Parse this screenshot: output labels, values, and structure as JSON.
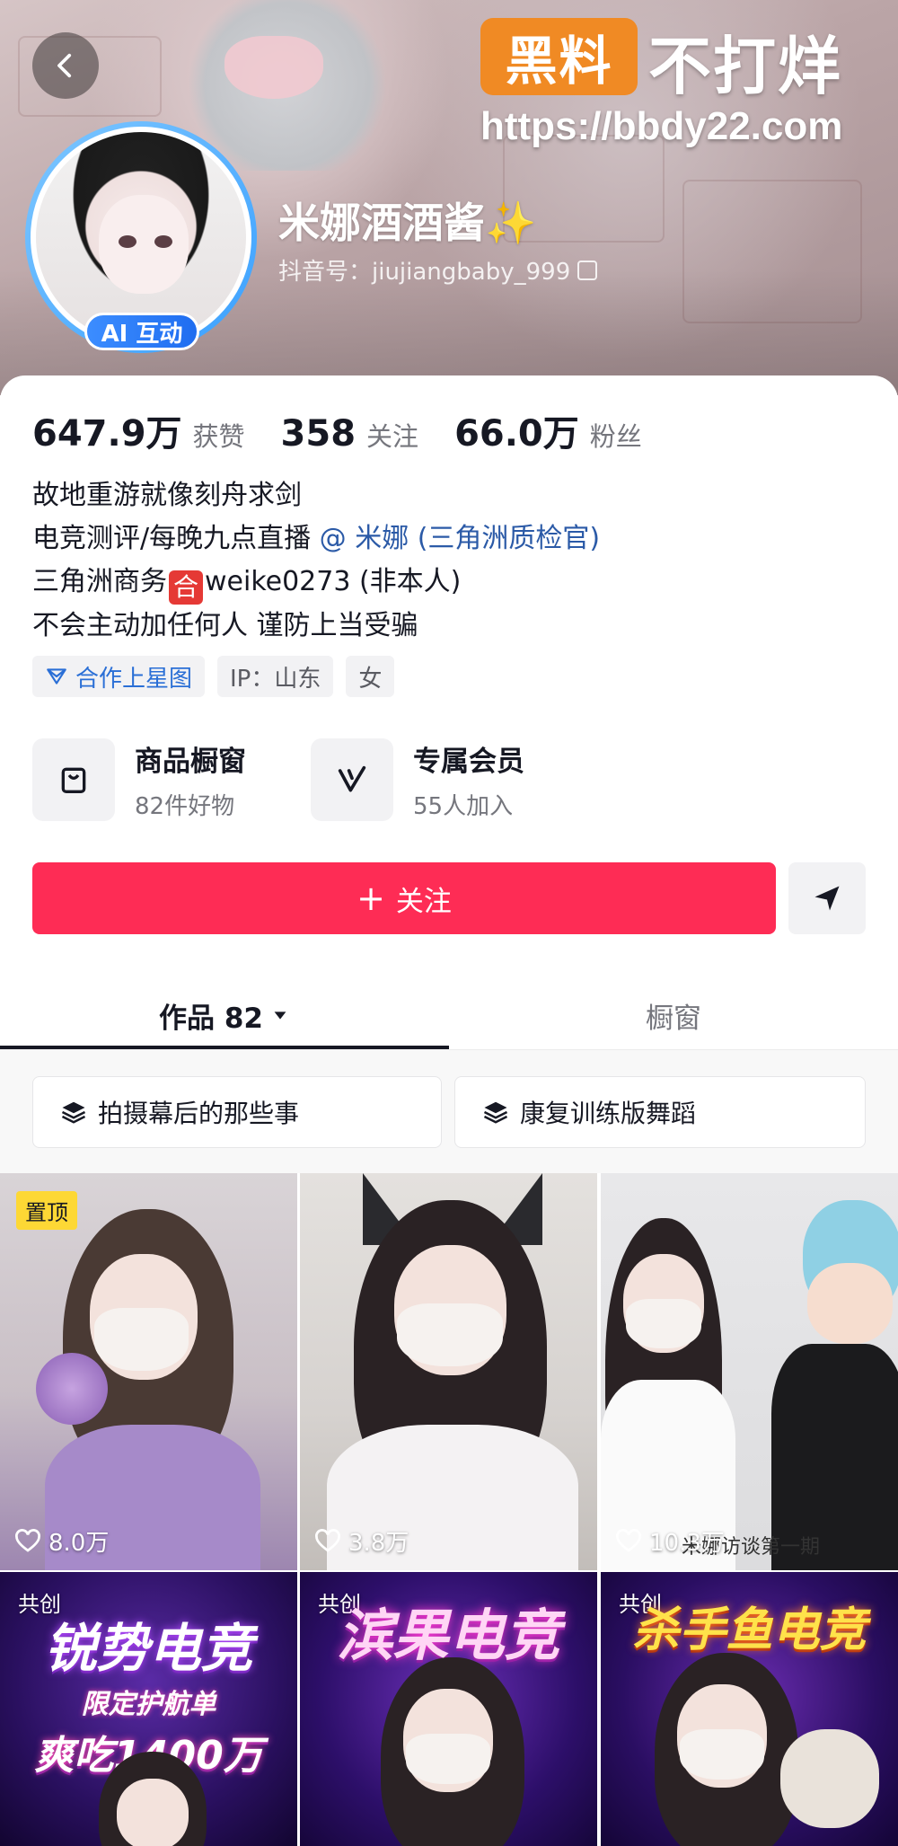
{
  "header": {
    "back_icon": "chevron-left-icon",
    "watermark_logo": "黑料",
    "watermark_text": "不打烊",
    "watermark_url": "https://bbdy22.com"
  },
  "profile": {
    "nickname": "米娜酒酒酱✨",
    "douyin_id": "抖音号：jiujiangbaby_999",
    "ai_badge": "AI 互动"
  },
  "stats": [
    {
      "value": "647.9万",
      "label": "获赞"
    },
    {
      "value": "358",
      "label": "关注"
    },
    {
      "value": "66.0万",
      "label": "粉丝"
    }
  ],
  "bio": {
    "line1": "故地重游就像刻舟求剑",
    "line2_prefix": "电竞测评/每晚九点直播",
    "line2_mention": "@ 米娜 (三角洲质检官)",
    "line3_prefix": "三角洲商务",
    "line3_icon": "合",
    "line3_suffix": "weike0273 (非本人)",
    "line4": "不会主动加任何人 谨防上当受骗"
  },
  "tags": {
    "star": "合作上星图",
    "ip": "IP：山东",
    "gender": "女"
  },
  "features": {
    "shop_title": "商品橱窗",
    "shop_sub": "82件好物",
    "member_title": "专属会员",
    "member_sub": "55人加入"
  },
  "actions": {
    "follow": "关注",
    "follow_plus": "+"
  },
  "tabs": {
    "works": "作品 82",
    "showcase": "橱窗"
  },
  "collections": {
    "c1": "拍摄幕后的那些事",
    "c2": "康复训练版舞蹈"
  },
  "videos": {
    "v1": {
      "badge": "置顶",
      "likes": "8.0万"
    },
    "v2": {
      "likes": "3.8万"
    },
    "v3": {
      "likes": "10.3万",
      "caption": "米娜访谈第一期"
    },
    "v4": {
      "badge": "共创",
      "title": "锐势电竞",
      "subtitle": "限定护航单",
      "subtitle2": "爽吃1400万"
    },
    "v5": {
      "badge": "共创",
      "title": "滨果电竞"
    },
    "v6": {
      "badge": "共创",
      "title": "杀手鱼电竞"
    }
  },
  "colors": {
    "follow": "#fe2c55",
    "mention": "#2b5aa7",
    "watermark": "#f08a24",
    "pin": "#fdd835"
  }
}
